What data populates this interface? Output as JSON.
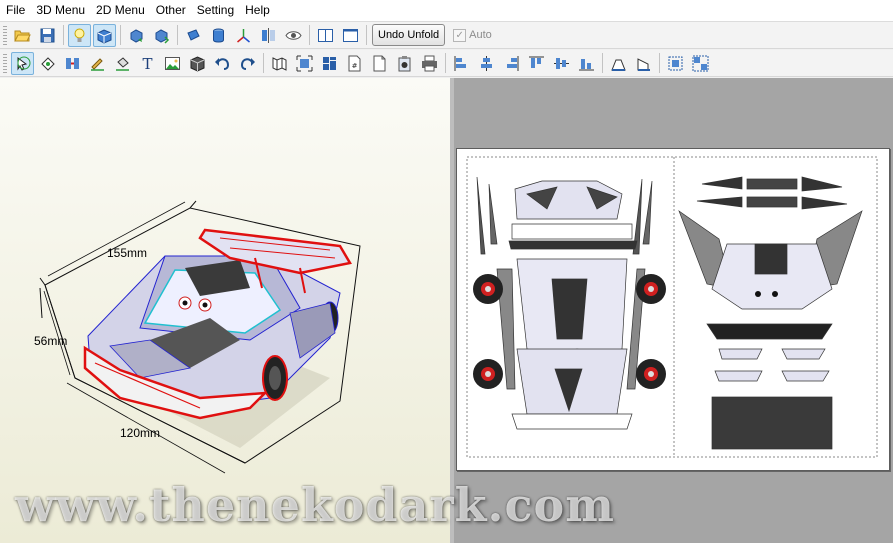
{
  "menu": [
    "File",
    "3D Menu",
    "2D Menu",
    "Other",
    "Setting",
    "Help"
  ],
  "toolbar1": {
    "undo_unfold_label": "Undo Unfold",
    "auto_label": "Auto",
    "auto_checked": true
  },
  "model_view": {
    "dimensions": {
      "length": "155mm",
      "height": "56mm",
      "width": "120mm"
    }
  },
  "watermark": "www.thenekodark.com",
  "colors": {
    "toolbar_bg": "#f3f3f3",
    "viewport_bg": "#f4f3e4",
    "pattern_bg": "#a5a5a5",
    "fold_edge": "#e01010",
    "model_edge": "#2323d0"
  }
}
